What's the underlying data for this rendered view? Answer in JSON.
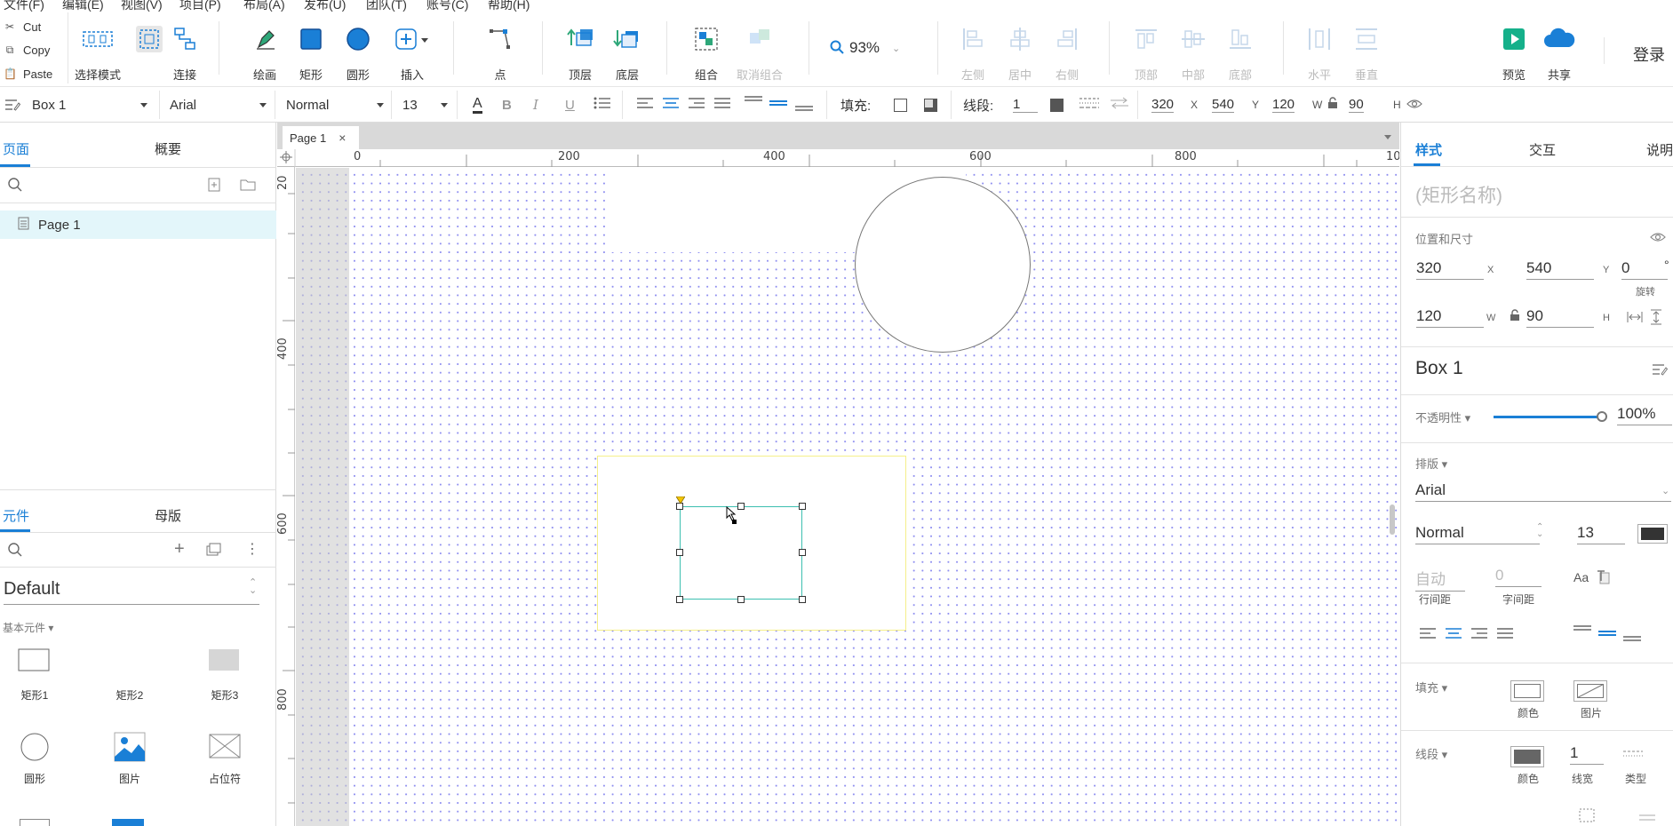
{
  "menu": [
    "文件(F)",
    "编辑(E)",
    "视图(V)",
    "项目(P)",
    "布局(A)",
    "发布(U)",
    "团队(T)",
    "账号(C)",
    "帮助(H)"
  ],
  "clipboard": {
    "cut": "Cut",
    "copy": "Copy",
    "paste": "Paste"
  },
  "toolbar": {
    "select_mode": "选择模式",
    "connect": "连接",
    "draw": "绘画",
    "rect": "矩形",
    "ellipse": "圆形",
    "insert": "插入",
    "point": "点",
    "top_layer": "顶层",
    "bottom_layer": "底层",
    "group": "组合",
    "ungroup": "取消组合",
    "zoom": "93%",
    "align_left": "左侧",
    "align_center": "居中",
    "align_right": "右侧",
    "align_top": "顶部",
    "align_middle": "中部",
    "align_bottom": "底部",
    "dist_h": "水平",
    "dist_v": "垂直",
    "preview": "预览",
    "share": "共享",
    "login": "登录"
  },
  "format": {
    "widget_name": "Box 1",
    "font": "Arial",
    "style": "Normal",
    "size": "13",
    "fill_label": "填充:",
    "stroke_label": "线段:",
    "stroke_width": "1",
    "x": "320",
    "y": "540",
    "w": "120",
    "h": "90",
    "x_unit": "X",
    "y_unit": "Y",
    "w_unit": "W",
    "h_unit": "H"
  },
  "left": {
    "tabs": [
      "页面",
      "概要"
    ],
    "page_item": "Page 1",
    "lib_tabs": [
      "元件",
      "母版"
    ],
    "library_name": "Default",
    "section": "基本元件 ▾",
    "widgets": [
      "矩形1",
      "矩形2",
      "矩形3",
      "圆形",
      "图片",
      "占位符"
    ]
  },
  "canvas": {
    "tab_title": "Page 1",
    "hruler": [
      "0",
      "200",
      "400",
      "600",
      "800",
      "10"
    ],
    "vruler": [
      "20",
      "400",
      "600",
      "800"
    ]
  },
  "right": {
    "tabs": [
      "样式",
      "交互",
      "说明"
    ],
    "name_placeholder": "(矩形名称)",
    "pos_label": "位置和尺寸",
    "x": "320",
    "y": "540",
    "rot": "0",
    "w": "120",
    "h": "90",
    "rot_label": "旋转",
    "deg": "°",
    "x_unit": "X",
    "y_unit": "Y",
    "w_unit": "W",
    "h_unit": "H",
    "box_name": "Box 1",
    "opacity_label": "不透明性 ▾",
    "opacity": "100%",
    "opacity_level": 1.0,
    "typo_label": "排版 ▾",
    "font": "Arial",
    "style": "Normal",
    "size": "13",
    "line_spacing": "自动",
    "char_spacing": "0",
    "line_spacing_label": "行间距",
    "char_spacing_label": "字间距",
    "fill_label": "填充 ▾",
    "color_label": "颜色",
    "image_label": "图片",
    "stroke_label": "线段 ▾",
    "stroke_width": "1",
    "stroke_width_label": "线宽",
    "stroke_type_label": "类型"
  },
  "colors": {
    "accent": "#1a7fd6",
    "selection": "#3cbfb0",
    "container": "#f5ef8a",
    "dots": "#8e8ef0"
  }
}
